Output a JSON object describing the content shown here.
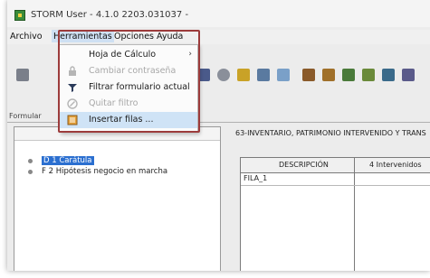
{
  "window": {
    "title": "STORM User - 4.1.0  2203.031037 -"
  },
  "menubar": {
    "items": [
      "Archivo",
      "Herramientas",
      "Opciones",
      "Ayuda"
    ]
  },
  "herramientas_menu": {
    "items": [
      {
        "label": "Hoja de Cálculo",
        "enabled": true,
        "submenu": true,
        "icon": "none"
      },
      {
        "label": "Cambiar contraseña",
        "enabled": false,
        "icon": "lock-icon"
      },
      {
        "label": "Filtrar formulario actual",
        "enabled": true,
        "icon": "filter-icon"
      },
      {
        "label": "Quitar filtro",
        "enabled": false,
        "icon": "remove-filter-icon"
      },
      {
        "label": "Insertar filas ...",
        "enabled": true,
        "highlighted": true,
        "icon": "insert-rows-icon"
      }
    ]
  },
  "toolbar": {
    "icons": [
      "save-icon",
      "undo-icon",
      "redo-icon",
      "filter-icon",
      "search-icon",
      "folder-icon",
      "grid-icon",
      "export-icon",
      "tool-icon",
      "tool-icon",
      "tool-icon",
      "tool-icon"
    ]
  },
  "formulario_label": "Formular",
  "tree": {
    "items": [
      {
        "label": "D 1 Carátula",
        "selected": true
      },
      {
        "label": "F 2 Hipótesis negocio en marcha",
        "selected": false
      }
    ]
  },
  "form_title": "63-INVENTARIO, PATRIMONIO INTERVENIDO Y TRANS",
  "grid": {
    "columns": [
      "DESCRIPCIÓN",
      "4 Intervenidos"
    ],
    "rows": [
      [
        "FILA_1",
        ""
      ]
    ]
  },
  "colors": {
    "annotation": "#9c3b3b",
    "highlight": "#cfe3f6",
    "selection": "#2b6fd0"
  }
}
